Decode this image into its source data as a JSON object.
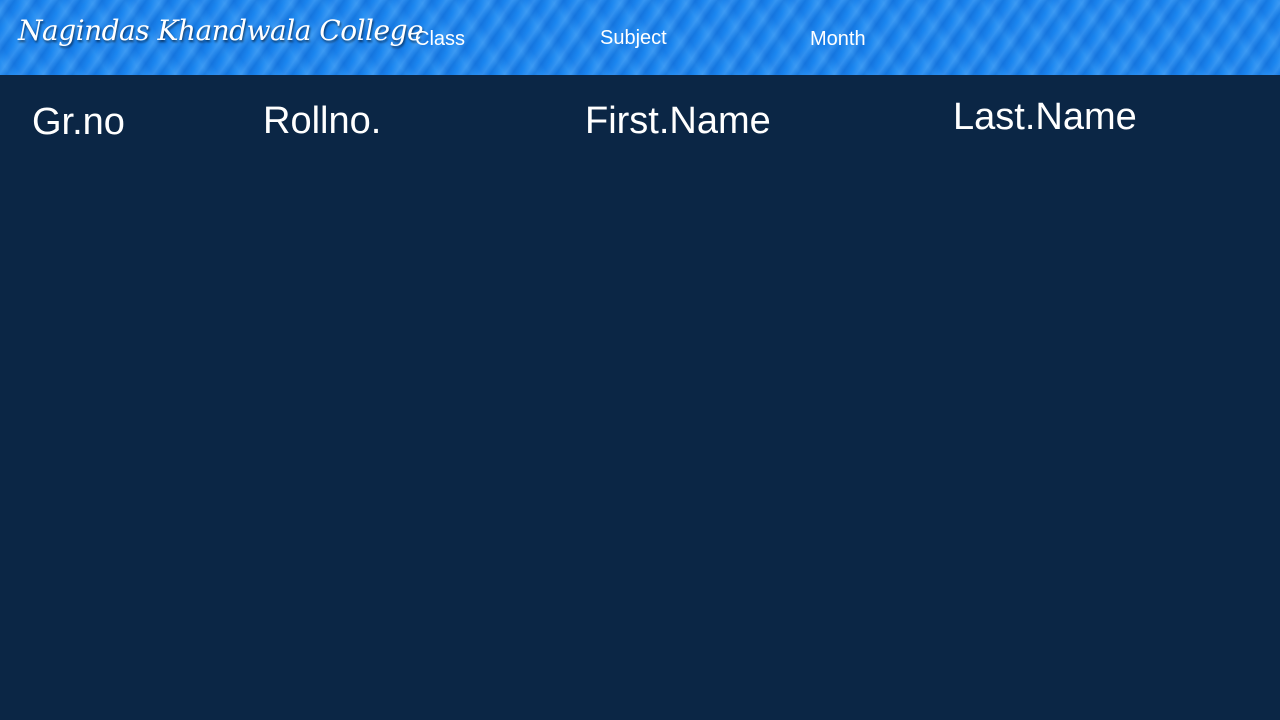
{
  "header": {
    "brand": "Nagindas Khandwala College",
    "nav": [
      {
        "label": "Class"
      },
      {
        "label": "Subject"
      },
      {
        "label": "Month"
      }
    ]
  },
  "table": {
    "columns": [
      "Gr.no",
      "Rollno.",
      "First.Name",
      "Last.Name"
    ]
  },
  "colors": {
    "header_bg": "#1a86f0",
    "page_bg": "#0b2645",
    "text": "#ffffff"
  }
}
